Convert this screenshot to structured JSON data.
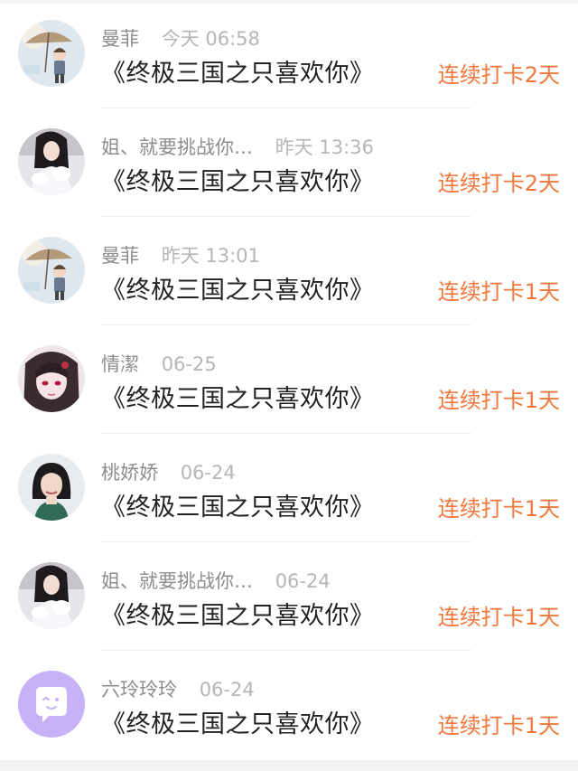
{
  "rows": [
    {
      "name": "曼菲",
      "time": "今天 06:58",
      "title": "《终极三国之只喜欢你》",
      "streak": "连续打卡2天",
      "avatar": "anime-boy-umbrella-avatar"
    },
    {
      "name": "姐、就要挑战你…",
      "time": "昨天 13:36",
      "title": "《终极三国之只喜欢你》",
      "streak": "连续打卡2天",
      "avatar": "girl-white-dress-avatar"
    },
    {
      "name": "曼菲",
      "time": "昨天 13:01",
      "title": "《终极三国之只喜欢你》",
      "streak": "连续打卡1天",
      "avatar": "anime-boy-umbrella-avatar"
    },
    {
      "name": "情潔",
      "time": "06-25",
      "title": "《终极三国之只喜欢你》",
      "streak": "连续打卡1天",
      "avatar": "anime-girl-red-eyes-avatar"
    },
    {
      "name": "桃娇娇",
      "time": "06-24",
      "title": "《终极三国之只喜欢你》",
      "streak": "连续打卡1天",
      "avatar": "woman-portrait-avatar"
    },
    {
      "name": "姐、就要挑战你…",
      "time": "06-24",
      "title": "《终极三国之只喜欢你》",
      "streak": "连续打卡1天",
      "avatar": "girl-white-dress-avatar"
    },
    {
      "name": "六玲玲玲",
      "time": "06-24",
      "title": "《终极三国之只喜欢你》",
      "streak": "连续打卡1天",
      "avatar": "default-chat-bubble-avatar"
    }
  ],
  "colors": {
    "streak": "#f0783c",
    "name": "#8d8d8d",
    "time": "#b6b6b6",
    "title": "#222222",
    "default_avatar_bg": "#c7b2f7"
  }
}
